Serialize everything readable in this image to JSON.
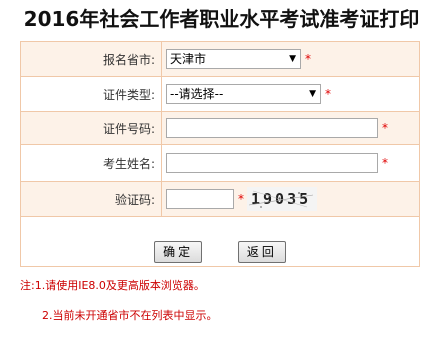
{
  "title": "2016年社会工作者职业水平考试准考证打印",
  "form": {
    "province": {
      "label": "报名省市:",
      "value": "天津市"
    },
    "id_type": {
      "label": "证件类型:",
      "value": "--请选择--"
    },
    "id_number": {
      "label": "证件号码:",
      "value": ""
    },
    "name": {
      "label": "考生姓名:",
      "value": ""
    },
    "captcha": {
      "label": "验证码:",
      "value": "",
      "image_text": "19035"
    },
    "required_mark": "*"
  },
  "buttons": {
    "confirm": "确定",
    "back": "返回"
  },
  "notes": {
    "line1": "注:1.请使用IE8.0及更高版本浏览器。",
    "line2": "2.当前未开通省市不在列表中显示。"
  },
  "colors": {
    "border": "#f0c8a8",
    "shade": "#fdf2e8",
    "required": "#e00000",
    "note": "#cc0000"
  }
}
